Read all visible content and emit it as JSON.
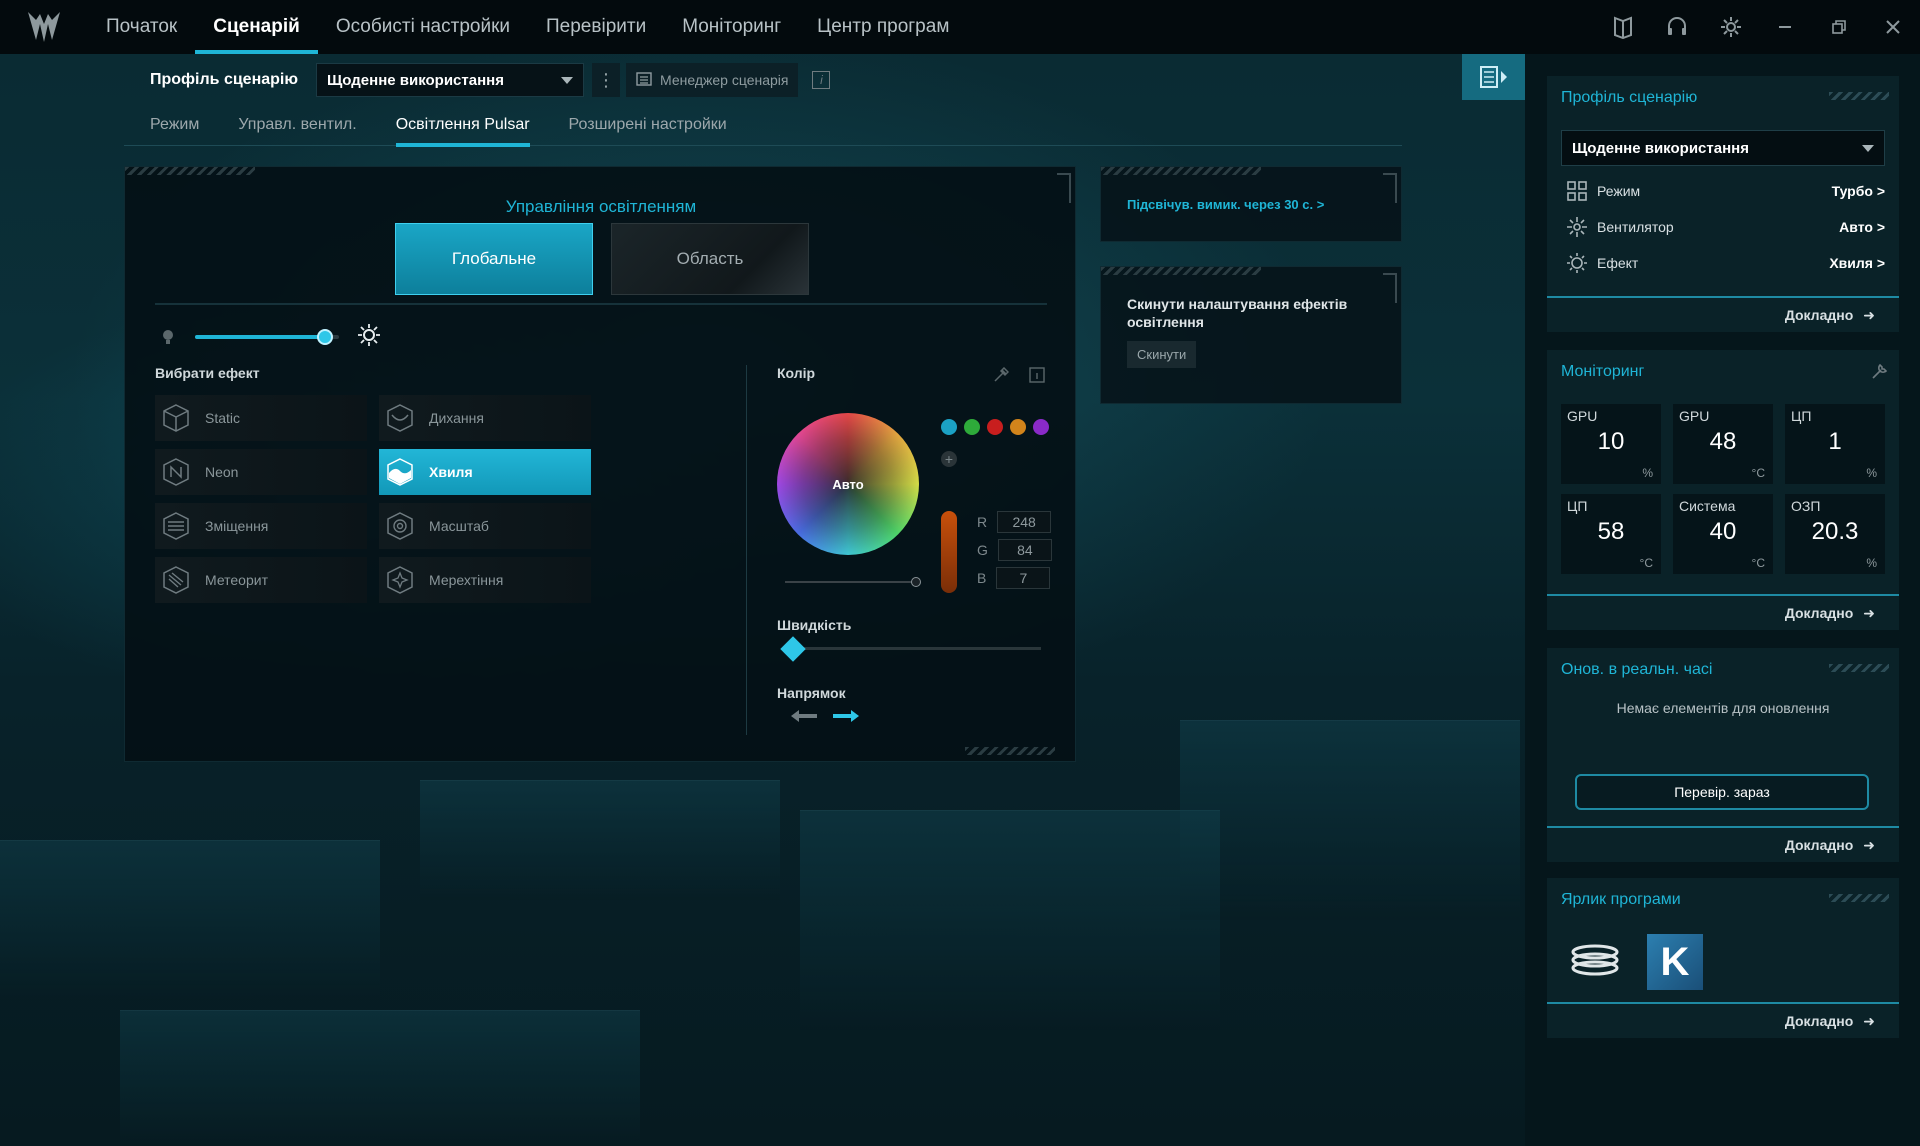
{
  "nav": {
    "items": [
      "Початок",
      "Сценарій",
      "Особисті настройки",
      "Перевірити",
      "Моніторинг",
      "Центр програм"
    ]
  },
  "profile": {
    "label": "Профіль сценарію",
    "selected": "Щоденне використання",
    "manager_label": "Менеджер сценарія"
  },
  "subtabs": [
    "Режим",
    "Управл. вентил.",
    "Освітлення Pulsar",
    "Розширені настройки"
  ],
  "lighting": {
    "title": "Управління освітленням",
    "mode_global": "Глобальне",
    "mode_area": "Область",
    "brightness_fraction": 0.9,
    "effects_label": "Вибрати ефект",
    "effects": [
      "Static",
      "Дихання",
      "Neon",
      "Хвиля",
      "Зміщення",
      "Масштаб",
      "Метеорит",
      "Мерехтіння"
    ],
    "selected_effect": "Хвиля",
    "color_label": "Колір",
    "wheel_text": "Авто",
    "swatches": [
      "#1ba1c4",
      "#2eaa3a",
      "#c81e1e",
      "#d2841b",
      "#8a2ac8"
    ],
    "rgb": {
      "r_label": "R",
      "r": "248",
      "g_label": "G",
      "g": "84",
      "b_label": "B",
      "b": "7"
    },
    "speed_label": "Швидкість",
    "speed_fraction": 0.03,
    "direction_label": "Напрямок"
  },
  "info_cards": {
    "timeout_link": "Підсвічув. вимик. через 30 с. >",
    "reset_text": "Скинути налаштування ефектів освітлення",
    "reset_button": "Скинути"
  },
  "sidebar": {
    "profile_title": "Профіль сценарію",
    "profile_selected": "Щоденне використання",
    "props": [
      {
        "icon": "grid-icon",
        "label": "Режим",
        "value": "Турбо >"
      },
      {
        "icon": "fan-icon",
        "label": "Вентилятор",
        "value": "Авто >"
      },
      {
        "icon": "sun-icon",
        "label": "Ефект",
        "value": "Хвиля >"
      }
    ],
    "details": "Докладно",
    "monitoring_title": "Моніторинг",
    "monitoring": [
      {
        "title": "GPU",
        "value": "10",
        "unit": "%"
      },
      {
        "title": "GPU",
        "value": "48",
        "unit": "°C"
      },
      {
        "title": "ЦП",
        "value": "1",
        "unit": "%"
      },
      {
        "title": "ЦП",
        "value": "58",
        "unit": "°C"
      },
      {
        "title": "Система",
        "value": "40",
        "unit": "°C"
      },
      {
        "title": "ОЗП",
        "value": "20.3",
        "unit": "%"
      }
    ],
    "realtime_title": "Онов. в реальн. часі",
    "realtime_empty": "Немає елементів для оновлення",
    "check_now": "Перевір. зараз",
    "shortcuts_title": "Ярлик програми",
    "shortcut_k": "K"
  },
  "colors": {
    "accent": "#1fb5d6",
    "selected": "#1aa6c6"
  }
}
